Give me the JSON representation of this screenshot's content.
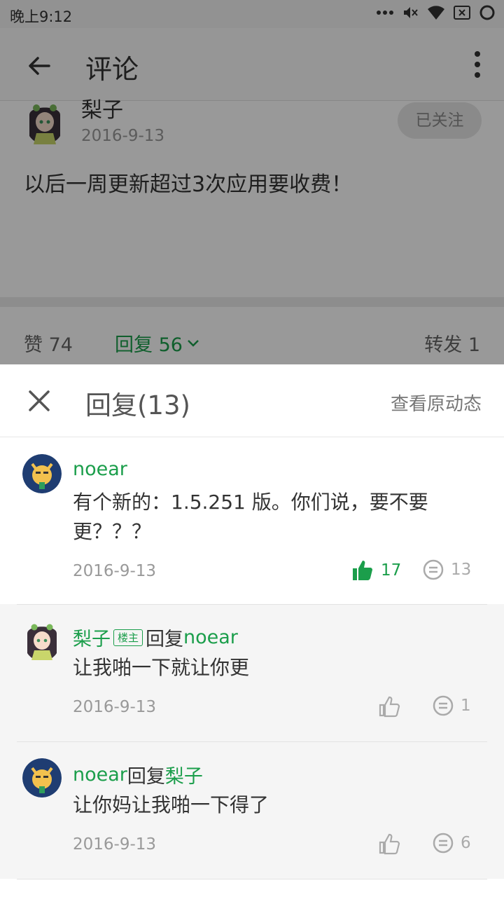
{
  "status_bar": {
    "time": "晚上9:12"
  },
  "app_bar": {
    "title": "评论"
  },
  "post": {
    "author": "梨子",
    "date": "2016-9-13",
    "follow_label": "已关注",
    "text": "以后一周更新超过3次应用要收费！"
  },
  "stats": {
    "likes": "赞 74",
    "replies": "回复 56",
    "forwards": "转发 1"
  },
  "sheet": {
    "title": "回复(13)",
    "view_original": "查看原动态"
  },
  "comments": [
    {
      "author": "noear",
      "text": "有个新的：1.5.251 版。你们说，要不要更？？？",
      "date": "2016-9-13",
      "likes": "17",
      "replies": "13"
    },
    {
      "author": "梨子",
      "badge": "楼主",
      "reply_word": "回复",
      "reply_to": "noear",
      "text": "让我啪一下就让你更",
      "date": "2016-9-13",
      "replies": "1"
    },
    {
      "author": "noear",
      "reply_word": "回复",
      "reply_to": "梨子",
      "text": "让你妈让我啪一下得了",
      "date": "2016-9-13",
      "replies": "6"
    }
  ],
  "colors": {
    "accent": "#1b9e4b",
    "muted": "#999999",
    "sheet_bg": "#ffffff",
    "reply_bg": "#f5f5f5"
  }
}
